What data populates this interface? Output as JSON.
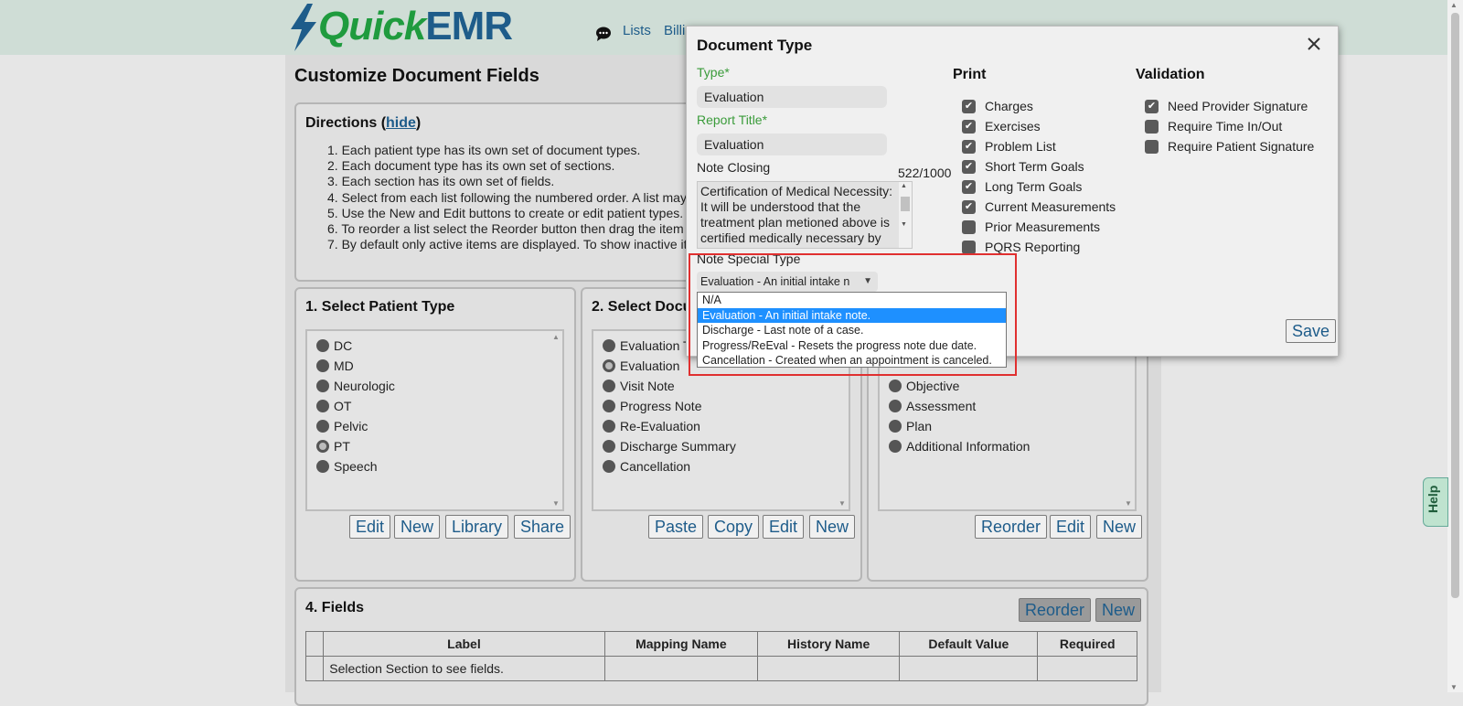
{
  "app": {
    "logo_quick": "Quick",
    "logo_emr": "EMR"
  },
  "nav": {
    "lists": "Lists",
    "billing": "Billi"
  },
  "page": {
    "title": "Customize Document Fields"
  },
  "directions": {
    "title": "Directions (",
    "hide": "hide",
    "close_paren": ")",
    "items": [
      "1. Each patient type has its own set of document types.",
      "2. Each document type has its own set of sections.",
      "3. Each section has its own set of fields.",
      "4. Select from each list following the numbered order. A list may",
      "5. Use the New and Edit buttons to create or edit patient types.",
      "6. To reorder a list select the Reorder button then drag the item",
      "7. By default only active items are displayed. To show inactive it"
    ]
  },
  "patient_type": {
    "title": "1. Select Patient Type",
    "items": [
      "DC",
      "MD",
      "Neurologic",
      "OT",
      "Pelvic",
      "PT",
      "Speech"
    ],
    "selected": "PT",
    "buttons": {
      "edit": "Edit",
      "new": "New",
      "library": "Library",
      "share": "Share"
    }
  },
  "document_type": {
    "title": "2. Select Docu",
    "items": [
      "Evaluation T",
      "Evaluation",
      "Visit Note",
      "Progress Note",
      "Re-Evaluation",
      "Discharge Summary",
      "Cancellation"
    ],
    "selected": "Evaluation",
    "buttons": {
      "paste": "Paste",
      "copy": "Copy",
      "edit": "Edit",
      "new": "New"
    }
  },
  "sections": {
    "items": [
      "Objective",
      "Assessment",
      "Plan",
      "Additional Information"
    ],
    "buttons": {
      "reorder": "Reorder",
      "edit": "Edit",
      "new": "New"
    }
  },
  "fields": {
    "title": "4. Fields",
    "buttons": {
      "reorder": "Reorder",
      "new": "New"
    },
    "columns": [
      "Label",
      "Mapping Name",
      "History Name",
      "Default Value",
      "Required"
    ],
    "empty_row": "Selection Section to see fields."
  },
  "modal": {
    "title": "Document Type",
    "type_label": "Type*",
    "type_value": "Evaluation",
    "report_title_label": "Report Title*",
    "report_title_value": "Evaluation",
    "note_closing_label": "Note Closing",
    "note_closing_count": "522/1000",
    "note_closing_text": "Certification of Medical Necessity: It will be understood that the treatment plan metioned above is certified medically necessary by the signing therapist.",
    "note_special_type_label": "Note Special Type",
    "note_special_type_value": "Evaluation - An initial intake n",
    "dropdown_options": [
      "N/A",
      "Evaluation - An initial intake note.",
      "Discharge - Last note of a case.",
      "Progress/ReEval - Resets the progress note due date.",
      "Cancellation - Created when an appointment is canceled."
    ],
    "dropdown_selected_index": 1,
    "print_title": "Print",
    "print_items": [
      {
        "label": "Charges",
        "checked": true
      },
      {
        "label": "Exercises",
        "checked": true
      },
      {
        "label": "Problem List",
        "checked": true
      },
      {
        "label": "Short Term Goals",
        "checked": true
      },
      {
        "label": "Long Term Goals",
        "checked": true
      },
      {
        "label": "Current Measurements",
        "checked": true
      },
      {
        "label": "Prior Measurements",
        "checked": false
      },
      {
        "label": "PQRS Reporting",
        "checked": false
      }
    ],
    "validation_title": "Validation",
    "validation_items": [
      {
        "label": "Need Provider Signature",
        "checked": true
      },
      {
        "label": "Require Time In/Out",
        "checked": false
      },
      {
        "label": "Require Patient Signature",
        "checked": false
      }
    ],
    "save_label": "Save"
  },
  "help_tab": {
    "label": "Help"
  },
  "colors": {
    "accent_blue": "#1e5c8a",
    "brand_green": "#1f9b3e",
    "highlight_red": "#e03030",
    "selected_option": "#1e90ff"
  }
}
